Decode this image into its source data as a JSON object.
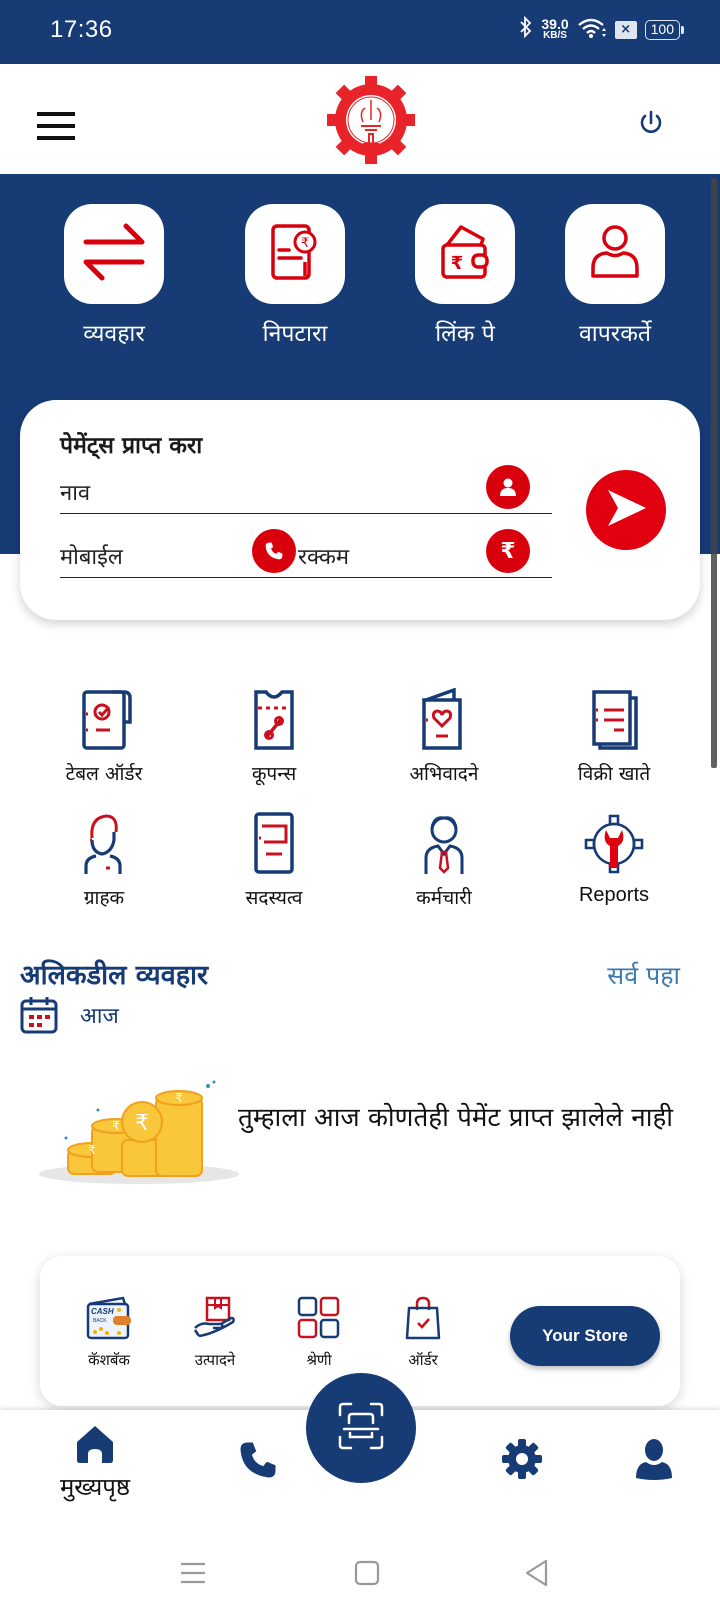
{
  "status_bar": {
    "time": "17:36",
    "network_speed_value": "39.0",
    "network_speed_unit": "KB/S",
    "sim_indicator": "×",
    "battery": "100"
  },
  "header": {
    "menu_icon": "hamburger-menu-icon",
    "logo": "emblem-logo",
    "power_icon": "power-icon"
  },
  "quick_actions": [
    {
      "label": "व्यवहार",
      "icon": "transfer-arrows-icon"
    },
    {
      "label": "निपटारा",
      "icon": "settlement-receipt-icon"
    },
    {
      "label": "लिंक पे",
      "icon": "wallet-icon"
    },
    {
      "label": "वापरकर्ते",
      "icon": "user-icon"
    }
  ],
  "payment_card": {
    "title": "पेमेंट्स प्राप्त करा",
    "name_placeholder": "नाव",
    "mobile_placeholder": "मोबाईल",
    "amount_placeholder": "रक्कम",
    "amount_icon_glyph": "₹"
  },
  "features": [
    {
      "label": "टेबल ऑर्डर",
      "icon": "table-order-icon"
    },
    {
      "label": "कूपन्स",
      "icon": "coupon-icon"
    },
    {
      "label": "अभिवादने",
      "icon": "greeting-card-icon"
    },
    {
      "label": "विक्री खाते",
      "icon": "sales-ledger-icon"
    },
    {
      "label": "ग्राहक",
      "icon": "customer-icon"
    },
    {
      "label": "सदस्यत्व",
      "icon": "membership-icon"
    },
    {
      "label": "कर्मचारी",
      "icon": "employee-icon"
    },
    {
      "label": "Reports",
      "icon": "reports-gear-icon"
    }
  ],
  "recent": {
    "title": "अलिकडील व्यवहार",
    "see_all": "सर्व पहा",
    "period": "आज",
    "empty_message": "तुम्हाला आज कोणतेही पेमेंट प्राप्त झालेले नाही"
  },
  "store": {
    "items": [
      {
        "label": "कॅशबॅक",
        "icon": "cashback-wallet-icon"
      },
      {
        "label": "उत्पादने",
        "icon": "products-icon"
      },
      {
        "label": "श्रेणी",
        "icon": "categories-icon"
      },
      {
        "label": "ऑर्डर",
        "icon": "order-bag-icon"
      }
    ],
    "button_label": "Your Store"
  },
  "bottom_nav": {
    "items": [
      {
        "label": "मुख्यपृष्ठ",
        "icon": "home-icon",
        "active": true
      },
      {
        "label": "",
        "icon": "phone-icon"
      },
      {
        "label": "",
        "icon": "settings-icon"
      },
      {
        "label": "",
        "icon": "profile-icon"
      }
    ],
    "scan_icon": "qr-scan-icon"
  },
  "colors": {
    "primary_blue": "#173b75",
    "accent_red": "#d9000d",
    "link_blue": "#3c7bab"
  }
}
